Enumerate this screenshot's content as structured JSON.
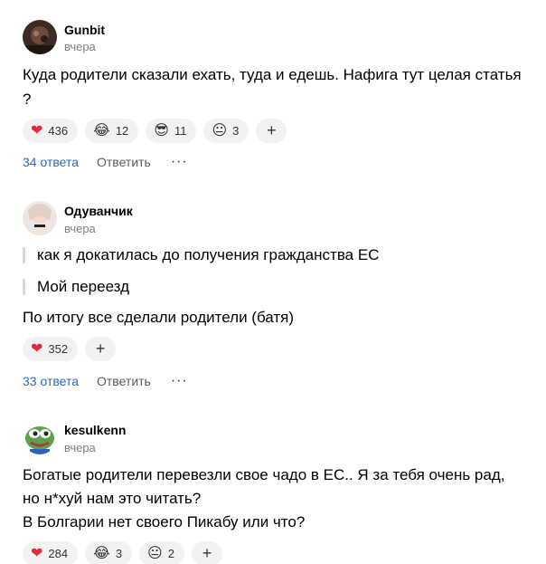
{
  "comments": [
    {
      "author": "Gunbit",
      "time": "вчера",
      "lines": [
        "Куда родители сказали ехать, туда и едешь. Нафига тут целая статья",
        "?"
      ],
      "reactions": [
        {
          "emoji": "❤",
          "count": "436"
        },
        {
          "emoji": "😂",
          "count": "12"
        },
        {
          "emoji": "😎",
          "count": "11"
        },
        {
          "emoji": "😐",
          "count": "3"
        }
      ],
      "add": "+",
      "replies": "34 ответа",
      "reply": "Ответить",
      "more": "···"
    },
    {
      "author": "Одуванчик",
      "time": "вчера",
      "quotes": [
        "как я докатилась до получения гражданства ЕС",
        "Мой переезд"
      ],
      "lines": [
        "По итогу все сделали родители (батя)"
      ],
      "reactions": [
        {
          "emoji": "❤",
          "count": "352"
        }
      ],
      "add": "+",
      "replies": "33 ответа",
      "reply": "Ответить",
      "more": "···"
    },
    {
      "author": "kesulkenn",
      "time": "вчера",
      "lines": [
        "Богатые родители перевезли свое чадо в ЕС.. Я за тебя очень рад,",
        "но н*хуй нам это читать?",
        "В Болгарии нет своего Пикабу или что?"
      ],
      "reactions": [
        {
          "emoji": "❤",
          "count": "284"
        },
        {
          "emoji": "😂",
          "count": "3"
        },
        {
          "emoji": "😐",
          "count": "2"
        }
      ],
      "add": "+"
    }
  ]
}
